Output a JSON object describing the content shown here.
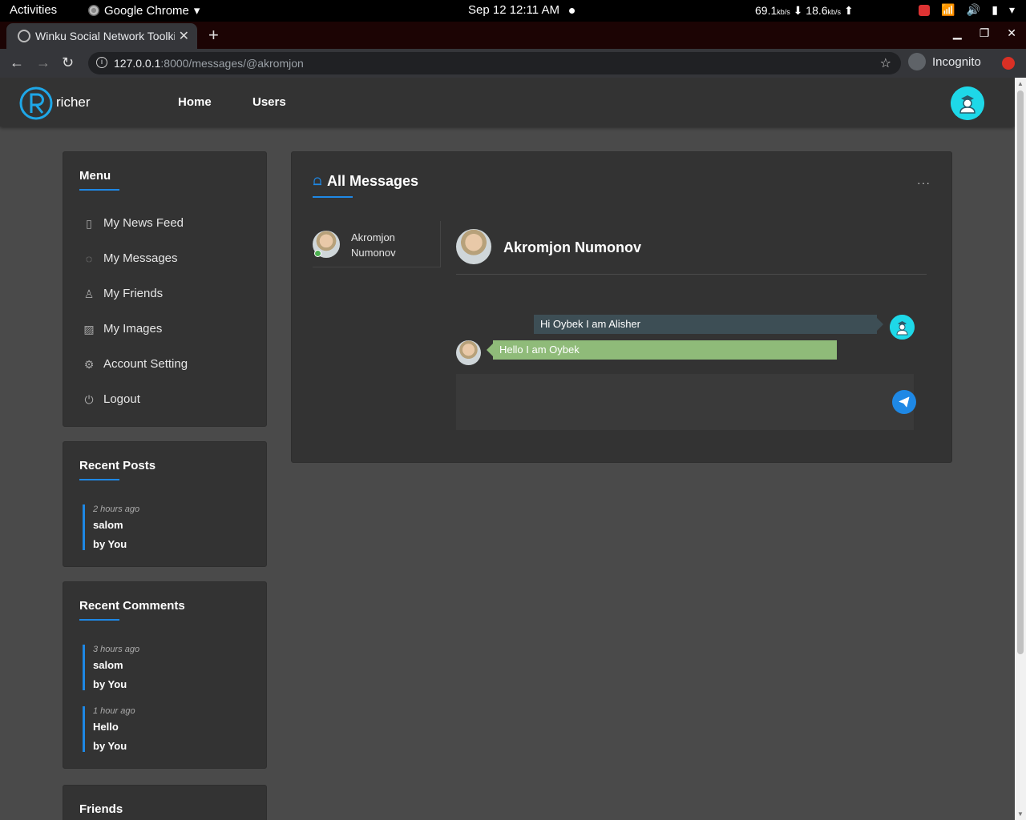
{
  "os_bar": {
    "activities": "Activities",
    "app_name": "Google Chrome",
    "clock": "Sep 12  12:11 AM",
    "down_speed": "69.1",
    "down_unit": "kb/s",
    "up_speed": "18.6",
    "up_unit": "kb/s"
  },
  "browser": {
    "tab_title": "Winku Social Network Toolkit",
    "url_host": "127.0.0.1",
    "url_rest": ":8000/messages/@akromjon",
    "incognito_label": "Incognito"
  },
  "header": {
    "brand": "richer",
    "nav": [
      "Home",
      "Users"
    ]
  },
  "menu": {
    "title": "Menu",
    "items": [
      {
        "label": "My News Feed",
        "icon": "clipboard-icon"
      },
      {
        "label": "My Messages",
        "icon": "chat-icon"
      },
      {
        "label": "My Friends",
        "icon": "user-icon"
      },
      {
        "label": "My Images",
        "icon": "image-icon"
      },
      {
        "label": "Account Setting",
        "icon": "gear-icon"
      },
      {
        "label": "Logout",
        "icon": "power-icon"
      }
    ]
  },
  "recent_posts": {
    "title": "Recent Posts",
    "items": [
      {
        "time": "2 hours ago",
        "title": "salom",
        "by": "by You"
      }
    ]
  },
  "recent_comments": {
    "title": "Recent Comments",
    "items": [
      {
        "time": "3 hours ago",
        "title": "salom",
        "by": "by You"
      },
      {
        "time": "1 hour ago",
        "title": "Hello",
        "by": "by You"
      }
    ]
  },
  "friends": {
    "title": "Friends"
  },
  "messages": {
    "title": "All Messages",
    "more": "···",
    "conversation": {
      "name": "Akromjon Numonov",
      "online": true
    },
    "chat_partner": "Akromjon Numonov",
    "thread": [
      {
        "from": "me",
        "text": "Hi Oybek I am Alisher"
      },
      {
        "from": "them",
        "text": "Hello I am Oybek"
      }
    ],
    "composer_value": ""
  },
  "colors": {
    "accent": "#1e88e5",
    "avatar_cyan": "#1ed8e8",
    "incoming_bubble": "#8fbb79",
    "outgoing_bubble": "#3d4e55",
    "online": "#4caf50"
  }
}
